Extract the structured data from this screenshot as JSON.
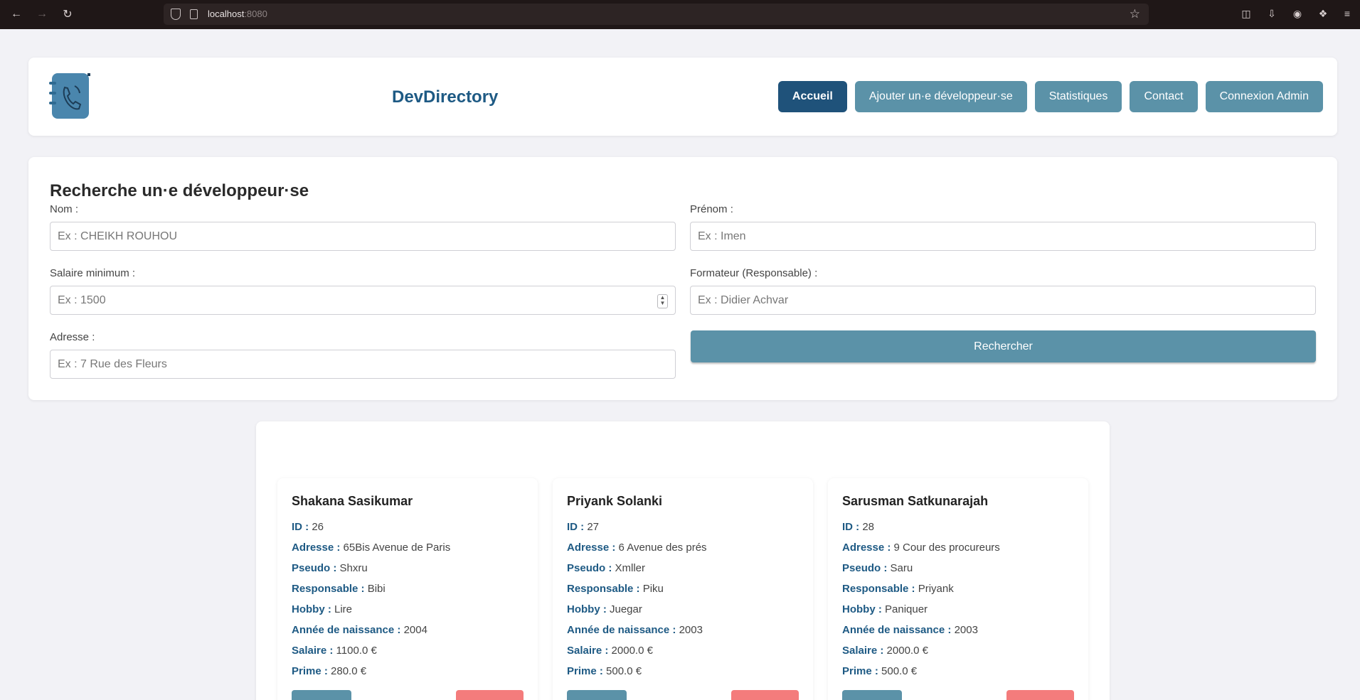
{
  "browser": {
    "url_host": "localhost",
    "url_port": ":8080"
  },
  "header": {
    "brand": "DevDirectory",
    "nav": [
      {
        "label": "Accueil",
        "active": true
      },
      {
        "label": "Ajouter un·e développeur·se",
        "active": false
      },
      {
        "label": "Statistiques",
        "active": false
      },
      {
        "label": "Contact",
        "active": false
      },
      {
        "label": "Connexion Admin",
        "active": false
      }
    ]
  },
  "search": {
    "title": "Recherche un·e développeur·se",
    "nom_label": "Nom :",
    "nom_placeholder": "Ex : CHEIKH ROUHOU",
    "prenom_label": "Prénom :",
    "prenom_placeholder": "Ex : Imen",
    "salaire_label": "Salaire minimum :",
    "salaire_placeholder": "Ex : 1500",
    "formateur_label": "Formateur (Responsable) :",
    "formateur_placeholder": "Ex : Didier Achvar",
    "adresse_label": "Adresse :",
    "adresse_placeholder": "Ex : 7 Rue des Fleurs",
    "button": "Rechercher"
  },
  "field_keys": {
    "id": "ID :",
    "adresse": "Adresse :",
    "pseudo": "Pseudo :",
    "responsable": "Responsable :",
    "hobby": "Hobby :",
    "naissance": "Année de naissance :",
    "salaire": "Salaire :",
    "prime": "Prime :"
  },
  "developers": [
    {
      "name": "Shakana Sasikumar",
      "id": "26",
      "adresse": "65Bis Avenue de Paris",
      "pseudo": "Shxru",
      "responsable": "Bibi",
      "hobby": "Lire",
      "naissance": "2004",
      "salaire": "1100.0 €",
      "prime": "280.0 €"
    },
    {
      "name": "Priyank Solanki",
      "id": "27",
      "adresse": "6 Avenue des prés",
      "pseudo": "Xmller",
      "responsable": "Piku",
      "hobby": "Juegar",
      "naissance": "2003",
      "salaire": "2000.0 €",
      "prime": "500.0 €"
    },
    {
      "name": "Sarusman Satkunarajah",
      "id": "28",
      "adresse": "9 Cour des procureurs",
      "pseudo": "Saru",
      "responsable": "Priyank",
      "hobby": "Paniquer",
      "naissance": "2003",
      "salaire": "2000.0 €",
      "prime": "500.0 €"
    }
  ],
  "colors": {
    "primary": "#5b92a8",
    "primary_dark": "#1f527a",
    "danger": "#f47c7c"
  }
}
